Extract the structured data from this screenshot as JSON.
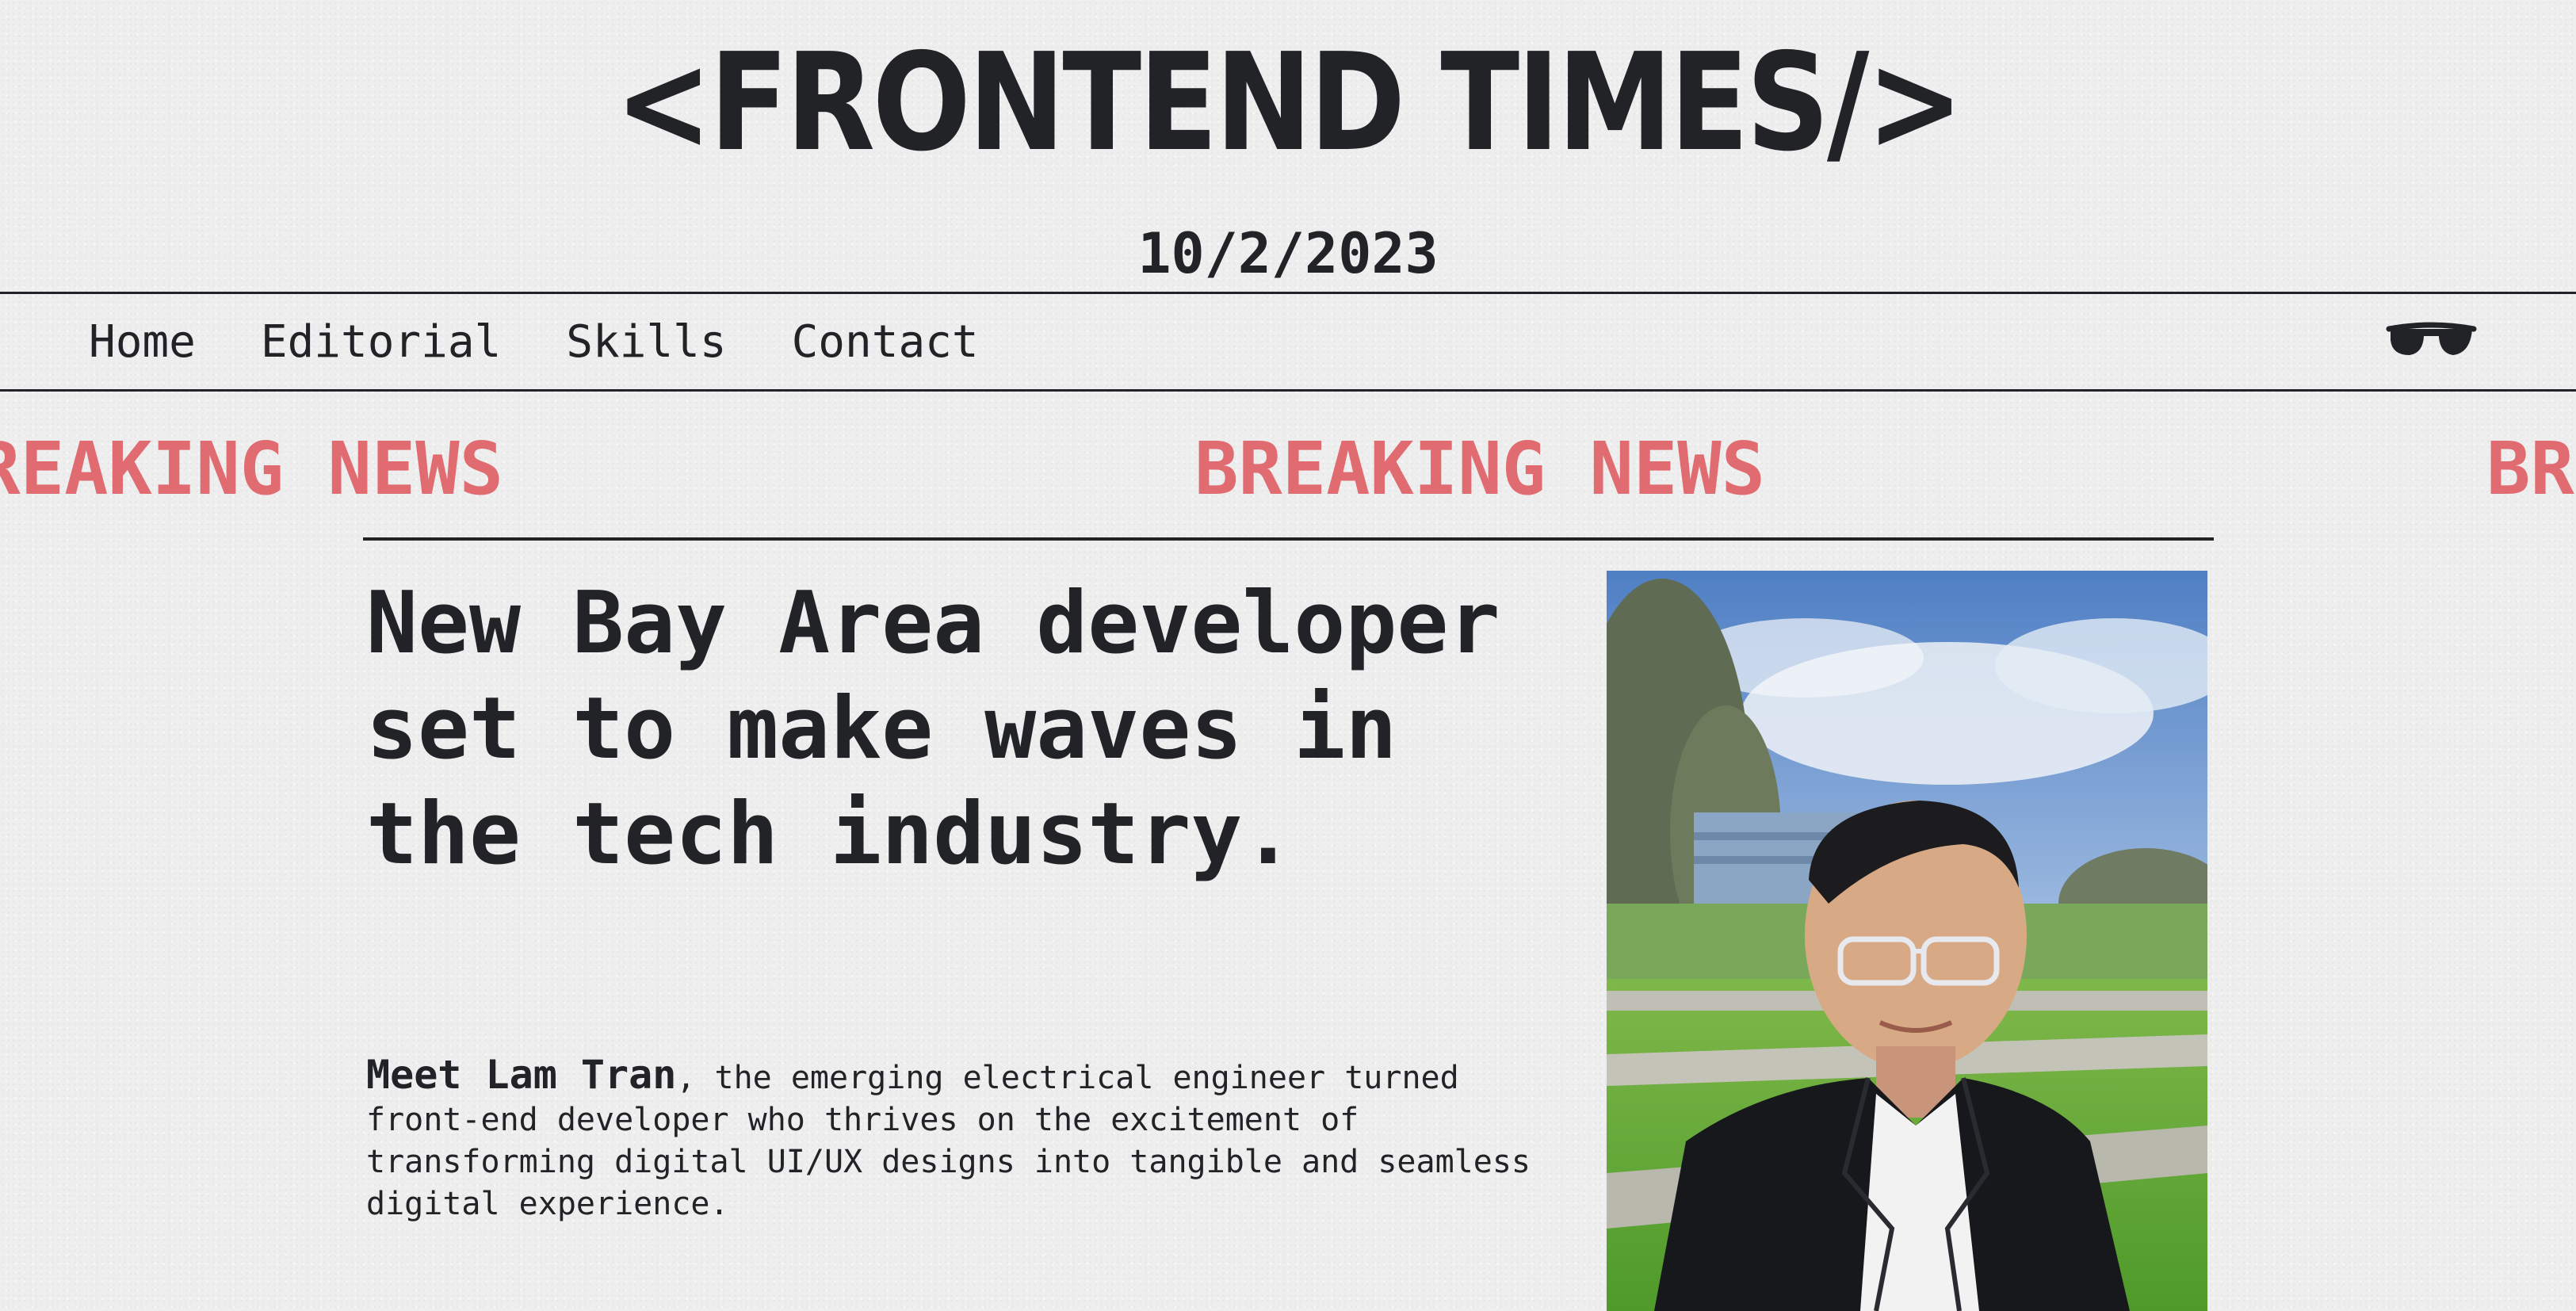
{
  "masthead": {
    "title": "<FRONTEND TIMES/>",
    "date": "10/2/2023"
  },
  "nav": {
    "items": [
      {
        "label": "Home"
      },
      {
        "label": "Editorial"
      },
      {
        "label": "Skills"
      },
      {
        "label": "Contact"
      }
    ],
    "theme_toggle_icon": "sunglasses-icon"
  },
  "ticker": {
    "items": [
      "BREAKING NEWS",
      "BREAKING NEWS",
      "BREAKING NEWS"
    ],
    "color": "#e06c71"
  },
  "article": {
    "headline": "New Bay Area developer set to make waves in the tech industry.",
    "intro_name": "Meet Lam Tran",
    "intro_text": ", the emerging electrical engineer turned front-end developer who thrives on the excitement of transforming digital UI/UX designs into tangible and seamless digital experience.",
    "photo_icon": "portrait-photo"
  },
  "colors": {
    "ink": "#222327",
    "paper": "#eeeeee",
    "accent": "#e06c71"
  }
}
